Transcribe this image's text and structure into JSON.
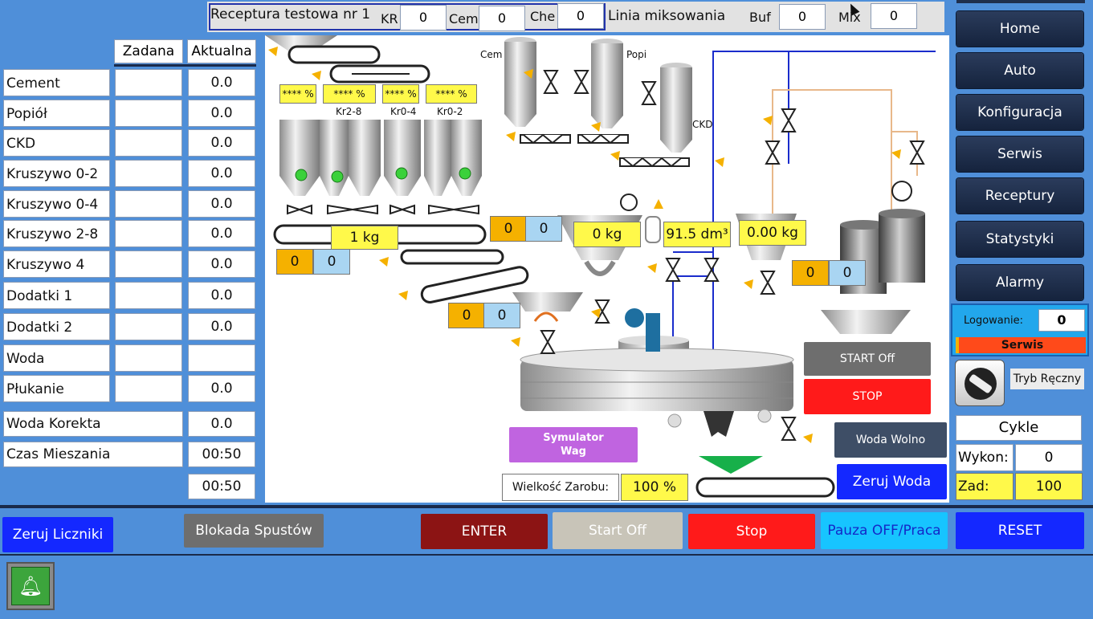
{
  "header": {
    "recipe": "Receptura testowa nr 1",
    "kr_label": "KR",
    "kr_value": "0",
    "cem_label": "Cem",
    "cem_value": "0",
    "che_label": "Che",
    "che_value": "0",
    "line_label": "Linia miksowania",
    "buf_label": "Buf",
    "buf_value": "0",
    "mix_label": "Mix",
    "mix_value": "0"
  },
  "table": {
    "col_set": "Zadana",
    "col_actual": "Aktualna",
    "rows": [
      {
        "label": "Cement",
        "actual": "0.0"
      },
      {
        "label": "Popiół",
        "actual": "0.0"
      },
      {
        "label": "CKD",
        "actual": "0.0"
      },
      {
        "label": "Kruszywo 0-2",
        "actual": "0.0"
      },
      {
        "label": "Kruszywo 0-4",
        "actual": "0.0"
      },
      {
        "label": "Kruszywo 2-8",
        "actual": "0.0"
      },
      {
        "label": "Kruszywo 4",
        "actual": "0.0"
      },
      {
        "label": "Dodatki 1",
        "actual": "0.0"
      },
      {
        "label": "Dodatki 2",
        "actual": "0.0"
      },
      {
        "label": "Woda",
        "actual": ""
      },
      {
        "label": "Płukanie",
        "actual": "0.0"
      }
    ],
    "water_correction_label": "Woda Korekta",
    "water_correction_value": "0.0",
    "mix_time_label": "Czas Mieszania",
    "mix_time_value": "00:50",
    "mix_time_actual": "00:50"
  },
  "nav": [
    "Home",
    "Auto",
    "Konfiguracja",
    "Serwis",
    "Receptury",
    "Statystyki",
    "Alarmy"
  ],
  "login": {
    "label": "Logowanie:",
    "value": "0",
    "role": "Serwis"
  },
  "manual_mode": "Tryb Ręczny",
  "cycles": {
    "title": "Cykle",
    "done_label": "Wykon:",
    "done_value": "0",
    "target_label": "Zad:",
    "target_value": "100"
  },
  "process": {
    "silo_labels": [
      "Cem",
      "Popi",
      "CKD"
    ],
    "aggregate_labels": [
      "Kr2-8",
      "Kr0-4",
      "Kr0-2"
    ],
    "percent_boxes": [
      "**** %",
      "**** %",
      "**** %",
      "**** %"
    ],
    "aggregate_scale": "1 kg",
    "cement_scale": "0 kg",
    "water_scale": "91.5 dm³",
    "additive_scale": "0.00 kg",
    "counter_pairs": [
      [
        "0",
        "0"
      ],
      [
        "0",
        "0"
      ],
      [
        "0",
        "0"
      ],
      [
        "0",
        "0"
      ]
    ],
    "simulator_button": "Symulator\nWag",
    "batch_size_label": "Wielkość Zarobu:",
    "batch_size_value": "100 %",
    "start_off": "START Off",
    "stop": "STOP",
    "slow_water": "Woda Wolno",
    "reset_water": "Zeruj Woda"
  },
  "bottom": {
    "reset_counters": "Zeruj Liczniki",
    "block_discharge": "Blokada Spustów",
    "enter": "ENTER",
    "start_off": "Start Off",
    "stop": "Stop",
    "pause": "Pauza OFF/Praca",
    "reset": "RESET"
  },
  "colors": {
    "background": "#4f8fd9",
    "nav": "#1f2f4d",
    "yellow": "#fff94a",
    "orange": "#f5b100",
    "stop_red": "#ff1a1a"
  }
}
